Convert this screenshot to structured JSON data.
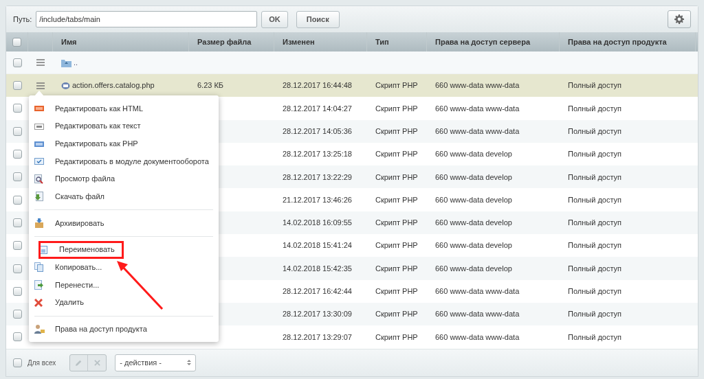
{
  "toolbar": {
    "path_label": "Путь:",
    "path_value": "/include/tabs/main",
    "ok_button": "OK",
    "search_button": "Поиск"
  },
  "table": {
    "header_checked": false,
    "columns": [
      "Имя",
      "Размер файла",
      "Изменен",
      "Тип",
      "Права на доступ сервера",
      "Права на доступ продукта"
    ],
    "parent_row": {
      "name": "..",
      "checked": false
    },
    "rows": [
      {
        "name": "action.offers.catalog.php",
        "size": "6.23 КБ",
        "modified": "28.12.2017 16:44:48",
        "type": "Скрипт PHP",
        "server_access": "660 www-data www-data",
        "product_access": "Полный доступ",
        "checked": false,
        "selected": true
      },
      {
        "modified": "28.12.2017 14:04:27",
        "type": "Скрипт PHP",
        "server_access": "660 www-data www-data",
        "product_access": "Полный доступ",
        "checked": false,
        "selected": false
      },
      {
        "modified": "28.12.2017 14:05:36",
        "type": "Скрипт PHP",
        "server_access": "660 www-data www-data",
        "product_access": "Полный доступ",
        "checked": false,
        "selected": false
      },
      {
        "modified": "28.12.2017 13:25:18",
        "type": "Скрипт PHP",
        "server_access": "660 www-data develop",
        "product_access": "Полный доступ",
        "checked": false,
        "selected": false
      },
      {
        "modified": "28.12.2017 13:22:29",
        "type": "Скрипт PHP",
        "server_access": "660 www-data develop",
        "product_access": "Полный доступ",
        "checked": false,
        "selected": false
      },
      {
        "modified": "21.12.2017 13:46:26",
        "type": "Скрипт PHP",
        "server_access": "660 www-data develop",
        "product_access": "Полный доступ",
        "checked": false,
        "selected": false
      },
      {
        "modified": "14.02.2018 16:09:55",
        "type": "Скрипт PHP",
        "server_access": "660 www-data develop",
        "product_access": "Полный доступ",
        "checked": false,
        "selected": false
      },
      {
        "modified": "14.02.2018 15:41:24",
        "type": "Скрипт PHP",
        "server_access": "660 www-data develop",
        "product_access": "Полный доступ",
        "checked": false,
        "selected": false
      },
      {
        "modified": "14.02.2018 15:42:35",
        "type": "Скрипт PHP",
        "server_access": "660 www-data develop",
        "product_access": "Полный доступ",
        "checked": false,
        "selected": false
      },
      {
        "modified": "28.12.2017 16:42:44",
        "type": "Скрипт PHP",
        "server_access": "660 www-data www-data",
        "product_access": "Полный доступ",
        "checked": false,
        "selected": false
      },
      {
        "modified": "28.12.2017 13:30:09",
        "type": "Скрипт PHP",
        "server_access": "660 www-data www-data",
        "product_access": "Полный доступ",
        "checked": false,
        "selected": false
      },
      {
        "modified": "28.12.2017 13:29:07",
        "type": "Скрипт PHP",
        "server_access": "660 www-data www-data",
        "product_access": "Полный доступ",
        "checked": false,
        "selected": false
      }
    ]
  },
  "context_menu": {
    "items": [
      {
        "kind": "item",
        "label": "Редактировать как HTML",
        "annotated": false
      },
      {
        "kind": "item",
        "label": "Редактировать как текст",
        "annotated": false
      },
      {
        "kind": "item",
        "label": "Редактировать как PHP",
        "annotated": false
      },
      {
        "kind": "item",
        "label": "Редактировать в модуле документооборота",
        "annotated": false
      },
      {
        "kind": "item",
        "label": "Просмотр файла",
        "annotated": false
      },
      {
        "kind": "item",
        "label": "Скачать файл",
        "annotated": false
      },
      {
        "kind": "separator"
      },
      {
        "kind": "item",
        "label": "Архивировать",
        "annotated": false
      },
      {
        "kind": "separator"
      },
      {
        "kind": "item",
        "label": "Переименовать",
        "annotated": true
      },
      {
        "kind": "item",
        "label": "Копировать...",
        "annotated": false
      },
      {
        "kind": "item",
        "label": "Перенести...",
        "annotated": false
      },
      {
        "kind": "item",
        "label": "Удалить",
        "annotated": false
      },
      {
        "kind": "separator"
      },
      {
        "kind": "item",
        "label": "Права на доступ продукта",
        "annotated": false
      }
    ]
  },
  "footer": {
    "select_all_checked": false,
    "select_all_label": "Для всех",
    "actions_select": "- действия -"
  }
}
